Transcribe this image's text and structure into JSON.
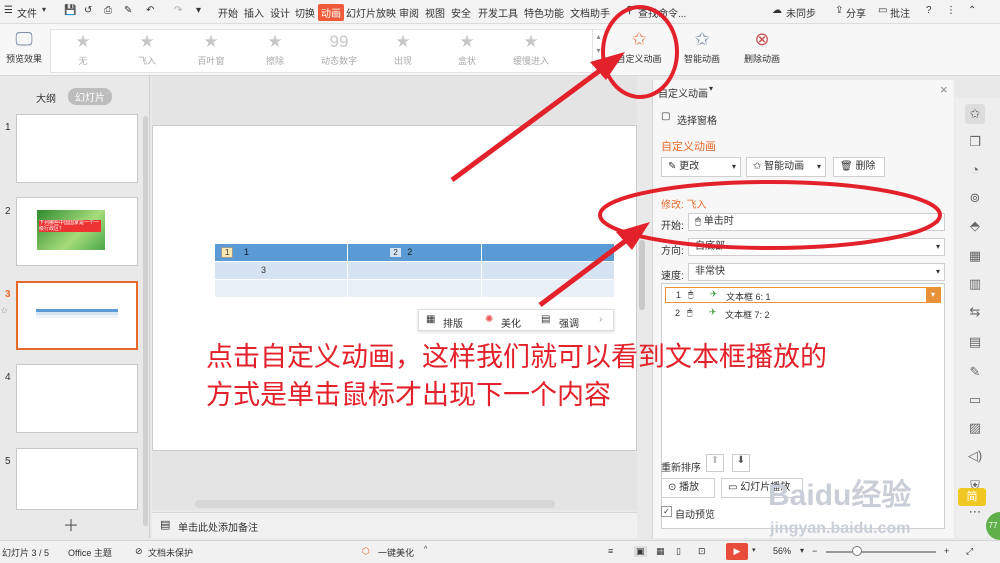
{
  "menu": {
    "file": "文件",
    "tabs": [
      "开始",
      "插入",
      "设计",
      "切换",
      "动画",
      "幻灯片放映",
      "审阅",
      "视图",
      "安全",
      "开发工具",
      "特色功能",
      "文档助手"
    ],
    "search": "查找命令...",
    "sync": "未同步",
    "share": "分享",
    "comment": "批注"
  },
  "ribbon": {
    "preview": "预览效果",
    "gallery": [
      "无",
      "飞入",
      "百叶窗",
      "擦除",
      "动态数字",
      "出现",
      "盒状",
      "缓慢进入"
    ],
    "custom": "自定义动画",
    "smart": "智能动画",
    "delete": "删除动画"
  },
  "left_panel": {
    "tab_outline": "大纲",
    "tab_slides": "幻灯片",
    "numbers": [
      "1",
      "2",
      "3",
      "4",
      "5"
    ],
    "slide2_text": "下列哪些中国国家是一个一级行政区？"
  },
  "slide_table": {
    "row1": [
      "1",
      "1",
      "2",
      "2"
    ],
    "row2": [
      "3"
    ]
  },
  "float_toolbar": {
    "layout": "排版",
    "beautify": "美化",
    "emphasize": "强调"
  },
  "notes_placeholder": "单击此处添加备注",
  "right_panel": {
    "title": "自定义动画",
    "select_pane": "选择窗格",
    "section": "自定义动画",
    "change": "更改",
    "smart": "智能动画",
    "delete": "删除",
    "modify": "修改: 飞入",
    "start_label": "开始:",
    "start_value": "单击时",
    "direction_label": "方向:",
    "direction_value": "自底部",
    "speed_label": "速度:",
    "speed_value": "非常快",
    "items": [
      {
        "num": "1",
        "label": "文本框 6: 1"
      },
      {
        "num": "2",
        "label": "文本框 7: 2"
      }
    ],
    "reorder": "重新排序",
    "play": "播放",
    "slideshow": "幻灯片播放",
    "auto_preview": "自动预览"
  },
  "status": {
    "slide": "幻灯片 3 / 5",
    "theme": "Office 主题",
    "protect": "文档未保护",
    "beautify": "一键美化",
    "zoom": "56%"
  },
  "annotation": {
    "line1": "点击自定义动画，这样我们就可以看到文本框播放的",
    "line2": "方式是单击鼠标才出现下一个内容"
  },
  "watermark": {
    "brand": "Baidu经验",
    "url": "jingyan.baidu.com",
    "badge": "77",
    "simple": "简"
  },
  "colors": {
    "accent": "#f05a38",
    "annotation_red": "#e3212b",
    "table_header": "#5b9bd5",
    "table_row": "#d6e3f3"
  }
}
